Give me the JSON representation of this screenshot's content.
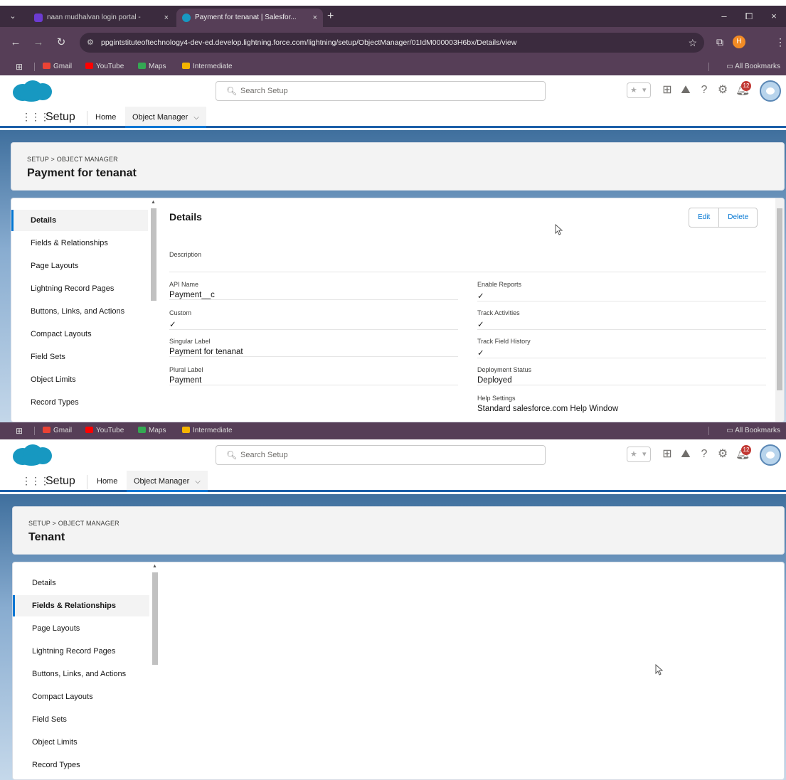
{
  "browser": {
    "tabs": [
      {
        "title": "naan mudhalvan login portal - ",
        "close": "×"
      },
      {
        "title": "Payment for tenanat | Salesfor...",
        "close": "×"
      }
    ],
    "new_tab": "+",
    "window_controls": [
      "–",
      "⧠",
      "×"
    ],
    "url": "ppgintstituteoftechnology4-dev-ed.develop.lightning.force.com/lightning/setup/ObjectManager/01IdM000003H6bx/Details/view",
    "profile_initial": "H",
    "bookmarks": [
      {
        "label": "Gmail",
        "color": "#ea4335"
      },
      {
        "label": "YouTube",
        "color": "#ff0000"
      },
      {
        "label": "Maps",
        "color": "#34a853"
      },
      {
        "label": "Intermediate",
        "color": "#f4b400"
      }
    ],
    "all_bookmarks": "All Bookmarks"
  },
  "colors": {
    "chrome_dark": "#3b2b3e",
    "chrome_mid": "#563e57",
    "sf_blue": "#0176d3",
    "sf_brand": "#1798c1",
    "notification_red": "#c23934"
  },
  "salesforce": {
    "search_placeholder": "Search Setup",
    "notification_count": "12",
    "app_name": "Setup",
    "nav": {
      "home": "Home",
      "object_manager": "Object Manager"
    },
    "breadcrumb": "SETUP > OBJECT MANAGER"
  },
  "panel1": {
    "object_title": "Payment for tenanat",
    "sidebar": [
      "Details",
      "Fields & Relationships",
      "Page Layouts",
      "Lightning Record Pages",
      "Buttons, Links, and Actions",
      "Compact Layouts",
      "Field Sets",
      "Object Limits",
      "Record Types"
    ],
    "active_item": "Details",
    "details": {
      "heading": "Details",
      "edit": "Edit",
      "delete": "Delete",
      "description_label": "Description",
      "description_value": "",
      "left_fields": [
        {
          "label": "API Name",
          "value": "Payment__c"
        },
        {
          "label": "Custom",
          "value": "✓"
        },
        {
          "label": "Singular Label",
          "value": "Payment for tenanat"
        },
        {
          "label": "Plural Label",
          "value": "Payment"
        }
      ],
      "right_fields": [
        {
          "label": "Enable Reports",
          "value": "✓"
        },
        {
          "label": "Track Activities",
          "value": "✓"
        },
        {
          "label": "Track Field History",
          "value": "✓"
        },
        {
          "label": "Deployment Status",
          "value": "Deployed"
        },
        {
          "label": "Help Settings",
          "value": "Standard salesforce.com Help Window"
        }
      ]
    }
  },
  "panel2": {
    "object_title": "Tenant",
    "sidebar": [
      "Details",
      "Fields & Relationships",
      "Page Layouts",
      "Lightning Record Pages",
      "Buttons, Links, and Actions",
      "Compact Layouts",
      "Field Sets",
      "Object Limits",
      "Record Types"
    ],
    "active_item": "Fields & Relationships"
  }
}
